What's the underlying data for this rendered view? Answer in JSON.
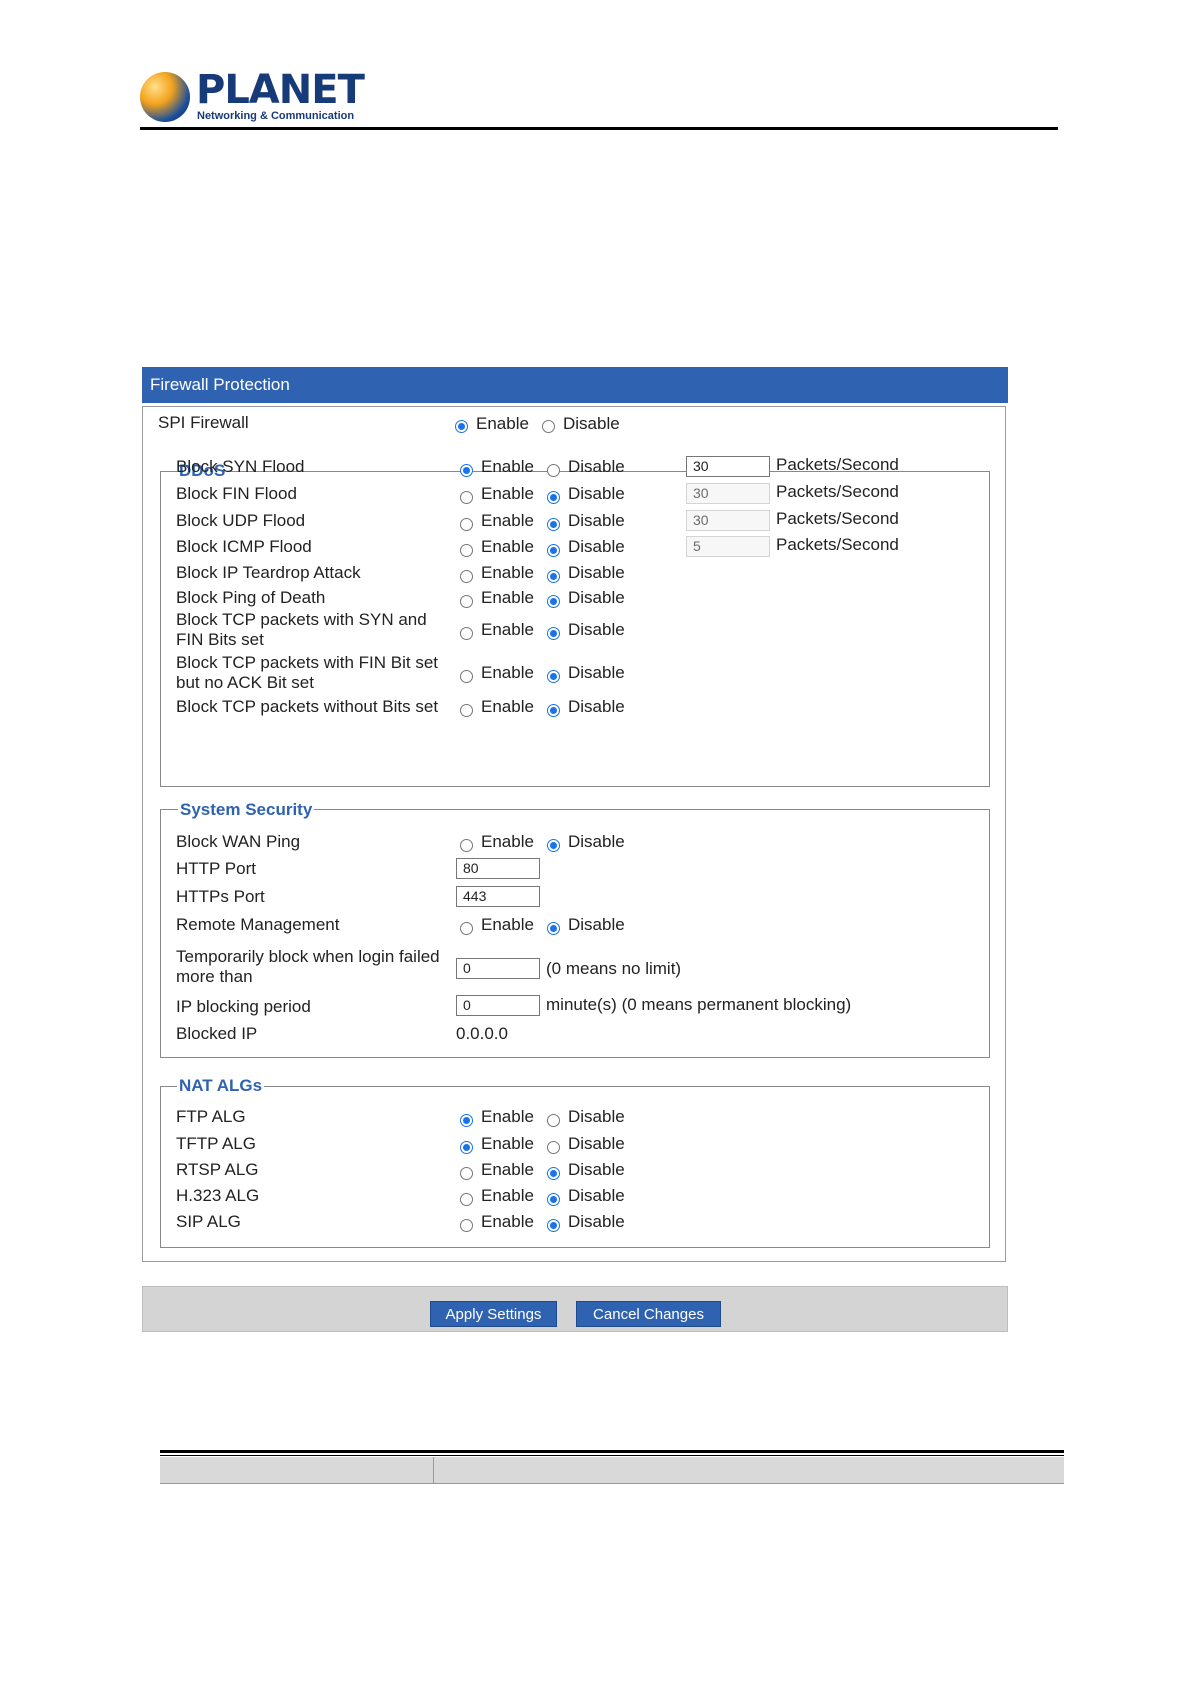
{
  "header": {
    "brand": "PLANET",
    "tagline": "Networking & Communication"
  },
  "panel": {
    "title": "Firewall Protection"
  },
  "spi": {
    "label": "SPI Firewall",
    "enable": "Enable",
    "disable": "Disable",
    "value": "enable"
  },
  "ddos": {
    "legend": "DDoS",
    "enable": "Enable",
    "disable": "Disable",
    "unit": "Packets/Second",
    "rows": [
      {
        "label": "Block SYN Flood",
        "value": "enable",
        "rate": "30"
      },
      {
        "label": "Block FIN Flood",
        "value": "disable",
        "rate": "30"
      },
      {
        "label": "Block UDP Flood",
        "value": "disable",
        "rate": "30"
      },
      {
        "label": "Block ICMP Flood",
        "value": "disable",
        "rate": "5"
      },
      {
        "label": "Block IP Teardrop Attack",
        "value": "disable"
      },
      {
        "label": "Block Ping of Death",
        "value": "disable"
      },
      {
        "label": "Block TCP packets with SYN and FIN Bits set",
        "value": "disable"
      },
      {
        "label": "Block TCP packets with FIN Bit set but no ACK Bit set",
        "value": "disable"
      },
      {
        "label": "Block TCP packets without Bits set",
        "value": "disable"
      }
    ]
  },
  "system": {
    "legend": "System Security",
    "enable": "Enable",
    "disable": "Disable",
    "wan_ping_label": "Block WAN Ping",
    "wan_ping_value": "disable",
    "http_label": "HTTP Port",
    "http_value": "80",
    "https_label": "HTTPs Port",
    "https_value": "443",
    "remote_label": "Remote Management",
    "remote_value": "disable",
    "login_block_label": "Temporarily block when login failed more than",
    "login_block_value": "0",
    "login_block_hint": "(0 means no limit)",
    "block_period_label": "IP blocking period",
    "block_period_value": "0",
    "block_period_hint": "minute(s) (0 means permanent blocking)",
    "blocked_ip_label": "Blocked IP",
    "blocked_ip_value": "0.0.0.0"
  },
  "nat": {
    "legend": "NAT ALGs",
    "enable": "Enable",
    "disable": "Disable",
    "rows": [
      {
        "label": "FTP ALG",
        "value": "enable"
      },
      {
        "label": "TFTP ALG",
        "value": "enable"
      },
      {
        "label": "RTSP ALG",
        "value": "disable"
      },
      {
        "label": "H.323 ALG",
        "value": "disable"
      },
      {
        "label": "SIP ALG",
        "value": "disable"
      }
    ]
  },
  "buttons": {
    "apply": "Apply Settings",
    "cancel": "Cancel Changes"
  },
  "colors": {
    "accent": "#2f62b0",
    "radio_checked": "#1a73e8",
    "button_bar": "#d4d4d4"
  }
}
